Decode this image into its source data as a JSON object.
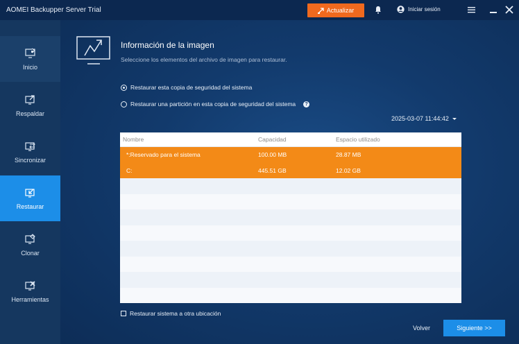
{
  "app": {
    "title": "AOMEI Backupper Server Trial",
    "upgrade_label": "Actualizar",
    "login_label": "Iniciar sesión"
  },
  "colors": {
    "accent_orange": "#f0691e",
    "accent_blue": "#1c8ee8",
    "selected_row": "#f38a17"
  },
  "icons": [
    "upgrade-arrow-icon",
    "bell-icon",
    "user-icon",
    "menu-icon",
    "minimize-icon",
    "close-icon",
    "image-info-icon",
    "help-icon",
    "dropdown-caret-icon"
  ],
  "sidebar": {
    "items": [
      {
        "label": "Inicio",
        "icon": "home-icon"
      },
      {
        "label": "Respaldar",
        "icon": "backup-icon"
      },
      {
        "label": "Sincronizar",
        "icon": "sync-icon"
      },
      {
        "label": "Restaurar",
        "icon": "restore-icon",
        "selected": true
      },
      {
        "label": "Clonar",
        "icon": "clone-icon"
      },
      {
        "label": "Herramientas",
        "icon": "tools-icon"
      }
    ]
  },
  "main": {
    "title": "Información de la imagen",
    "subtitle": "Seleccione los elementos del archivo de imagen para restaurar.",
    "options": [
      {
        "label": "Restaurar esta copia de seguridad del sistema",
        "selected": true
      },
      {
        "label": "Restaurar una partición en esta copia de seguridad del sistema",
        "selected": false
      }
    ],
    "backup_date": "2025-03-07 11:44:42",
    "table": {
      "headers": [
        "Nombre",
        "Capacidad",
        "Espacio utilizado"
      ],
      "rows": [
        {
          "name": "*:Reservado para el sistema",
          "capacity": "100.00 MB",
          "used": "28.87 MB"
        },
        {
          "name": "C:",
          "capacity": "445.51 GB",
          "used": "12.02 GB"
        }
      ]
    },
    "restore_other_location": "Restaurar sistema a otra ubicación",
    "restore_other_checked": false,
    "back_label": "Volver",
    "next_label": "Siguiente >>"
  }
}
